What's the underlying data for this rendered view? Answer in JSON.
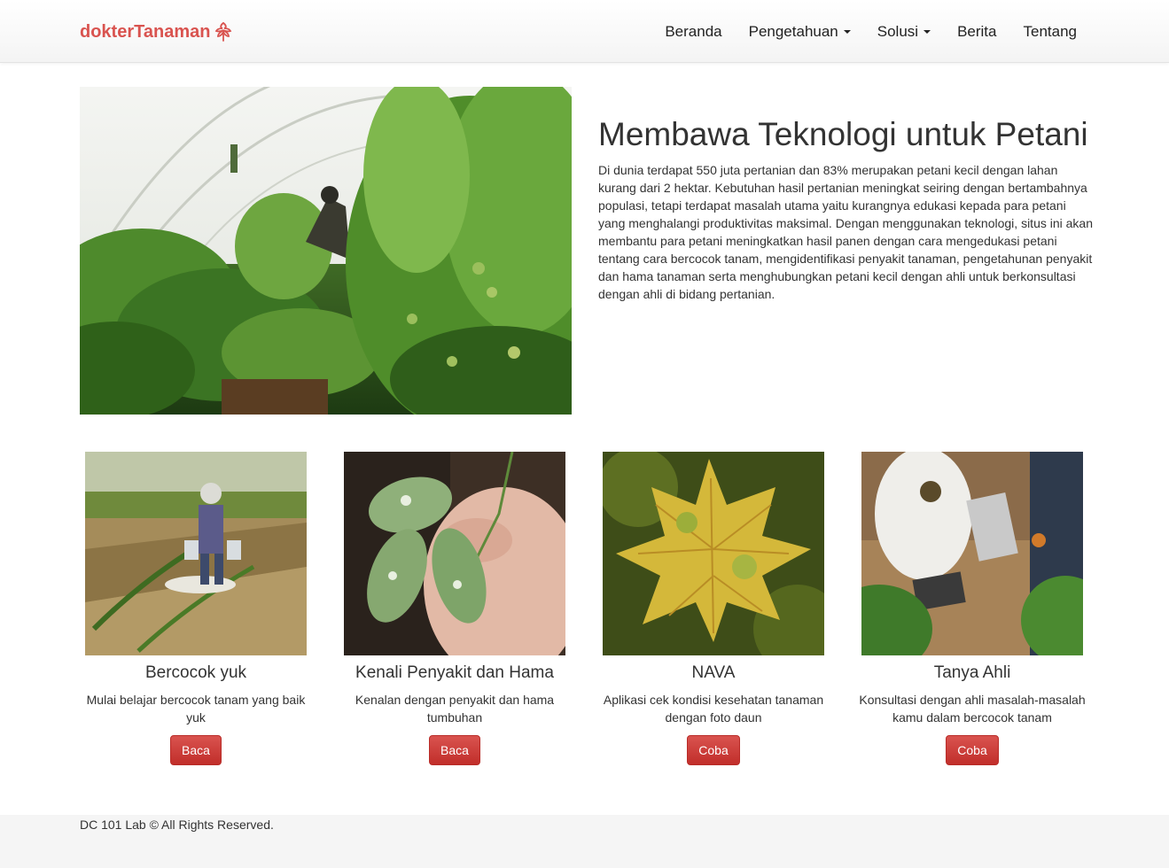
{
  "brand": {
    "name": "dokterTanaman",
    "icon": "leaf-icon",
    "color": "#d9534f"
  },
  "nav": {
    "items": [
      {
        "label": "Beranda",
        "dropdown": false
      },
      {
        "label": "Pengetahuan",
        "dropdown": true
      },
      {
        "label": "Solusi",
        "dropdown": true
      },
      {
        "label": "Berita",
        "dropdown": false
      },
      {
        "label": "Tentang",
        "dropdown": false
      }
    ]
  },
  "hero": {
    "image": "greenhouse-photo",
    "title": "Membawa Teknologi untuk Petani",
    "text": "Di dunia terdapat 550 juta pertanian dan 83% merupakan petani kecil dengan lahan kurang dari 2 hektar. Kebutuhan hasil pertanian meningkat seiring dengan bertambahnya populasi, tetapi terdapat masalah utama yaitu kurangnya edukasi kepada para petani yang menghalangi produktivitas maksimal. Dengan menggunakan teknologi, situs ini akan membantu para petani meningkatkan hasil panen dengan cara mengedukasi petani tentang cara bercocok tanam, mengidentifikasi penyakit tanaman, pengetahunan penyakit dan hama tanaman serta menghubungkan petani kecil dengan ahli untuk berkonsultasi dengan ahli di bidang pertanian."
  },
  "cards": [
    {
      "image": "farmer-field-photo",
      "title": "Bercocok yuk",
      "text": "Mulai belajar bercocok tanam yang baik yuk",
      "button": "Baca"
    },
    {
      "image": "diseased-leaf-photo",
      "title": "Kenali Penyakit dan Hama",
      "text": "Kenalan dengan penyakit dan hama tumbuhan",
      "button": "Baca"
    },
    {
      "image": "autumn-leaf-photo",
      "title": "NAVA",
      "text": "Aplikasi cek kondisi kesehatan tanaman dengan foto daun",
      "button": "Coba"
    },
    {
      "image": "consultation-photo",
      "title": "Tanya Ahli",
      "text": "Konsultasi dengan ahli masalah-masalah kamu dalam bercocok tanam",
      "button": "Coba"
    }
  ],
  "footer": {
    "text": "DC 101 Lab © All Rights Reserved."
  },
  "colors": {
    "accent": "#d9534f",
    "button": "#c9302c",
    "footer_bg": "#f5f5f5"
  }
}
